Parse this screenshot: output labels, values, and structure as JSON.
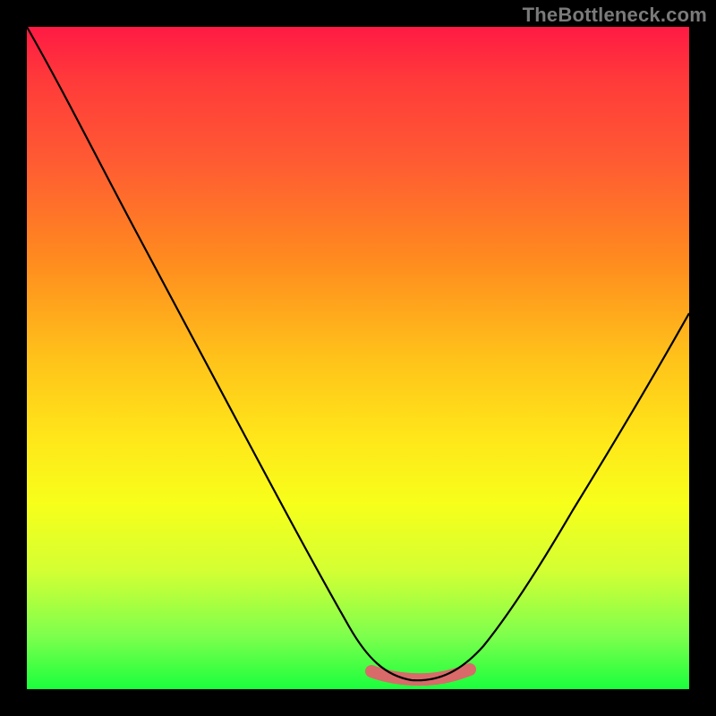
{
  "branding": {
    "watermark": "TheBottleneck.com"
  },
  "chart_data": {
    "type": "line",
    "title": "",
    "xlabel": "",
    "ylabel": "",
    "xlim": [
      0,
      100
    ],
    "ylim": [
      0,
      100
    ],
    "series": [
      {
        "name": "bottleneck-curve",
        "x": [
          0,
          5,
          10,
          15,
          20,
          25,
          30,
          35,
          40,
          45,
          50,
          52,
          55,
          58,
          60,
          62,
          65,
          70,
          75,
          80,
          85,
          90,
          95,
          100
        ],
        "values": [
          100,
          92,
          84,
          76,
          68,
          60,
          51,
          42,
          33,
          24,
          15,
          10,
          6,
          3,
          2,
          2,
          3,
          6,
          12,
          20,
          29,
          38,
          48,
          58
        ]
      }
    ],
    "highlight_range_x": [
      52,
      67
    ],
    "background_gradient": [
      "#ff1a44",
      "#ffc21a",
      "#f7ff1a",
      "#1aff3d"
    ]
  }
}
